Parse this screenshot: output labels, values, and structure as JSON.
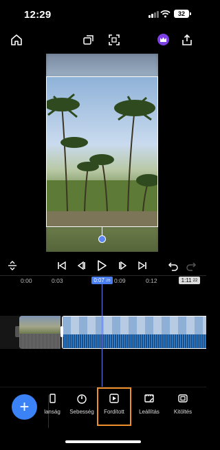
{
  "status": {
    "time": "12:29",
    "battery": "32"
  },
  "timeline": {
    "ticks": [
      "0:00",
      "0:03",
      "0:09",
      "0:12"
    ],
    "current": "0:07",
    "current_frames": "26",
    "duration": "1:11",
    "duration_frames": "22"
  },
  "toolbar": {
    "add_label": "+",
    "items": [
      {
        "label": "lanság",
        "icon": "partial-icon"
      },
      {
        "label": "Sebesség",
        "icon": "speed-icon"
      },
      {
        "label": "Fordított",
        "icon": "reverse-icon"
      },
      {
        "label": "Leállítás",
        "icon": "freeze-icon"
      },
      {
        "label": "Kitöltés",
        "icon": "fill-icon"
      }
    ],
    "active_index": 2
  },
  "colors": {
    "accent": "#3b82f6",
    "active_border": "#f0902a",
    "crown": "#7b3fe4"
  }
}
